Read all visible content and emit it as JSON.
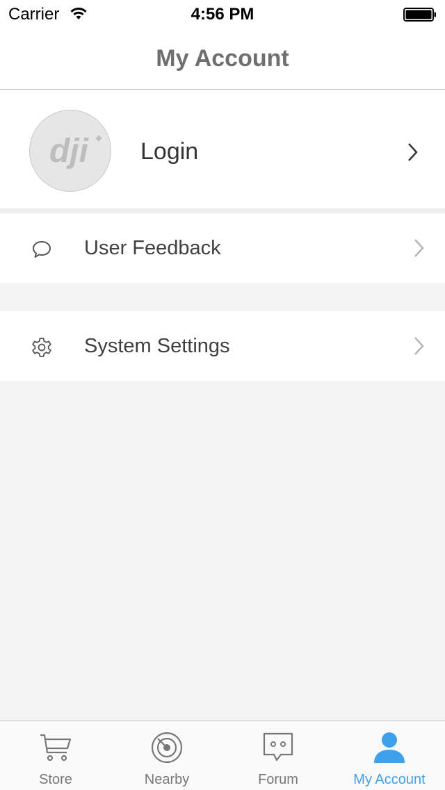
{
  "status_bar": {
    "carrier": "Carrier",
    "time": "4:56 PM",
    "wifi_icon": "wifi-icon",
    "battery_icon": "battery-icon"
  },
  "nav": {
    "title": "My Account"
  },
  "profile": {
    "avatar_logo_text": "dji",
    "login_label": "Login",
    "chevron_icon": "chevron-right-icon"
  },
  "menu": [
    {
      "label": "User Feedback",
      "icon": "speech-bubble-icon"
    },
    {
      "label": "System Settings",
      "icon": "gear-icon"
    }
  ],
  "tabs": [
    {
      "label": "Store",
      "icon": "cart-icon",
      "active": false
    },
    {
      "label": "Nearby",
      "icon": "radar-icon",
      "active": false
    },
    {
      "label": "Forum",
      "icon": "chat-icon",
      "active": false
    },
    {
      "label": "My Account",
      "icon": "person-icon",
      "active": true
    }
  ],
  "colors": {
    "accent": "#3fa1ec",
    "background": "#f3f3f3",
    "inactive_tab": "#777777",
    "title": "#6f6f6f"
  }
}
